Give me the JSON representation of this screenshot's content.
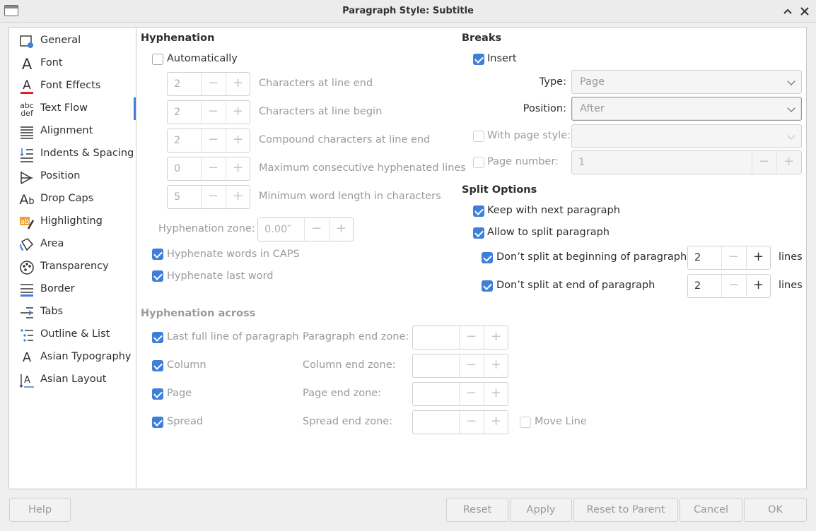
{
  "window": {
    "title": "Paragraph Style: Subtitle",
    "collapse_icon": "chevron-up-icon",
    "close_icon": "close-icon"
  },
  "sidebar": {
    "items": [
      {
        "label": "General",
        "icon": "general-icon"
      },
      {
        "label": "Font",
        "icon": "font-icon"
      },
      {
        "label": "Font Effects",
        "icon": "font-effects-icon"
      },
      {
        "label": "Text Flow",
        "icon": "text-flow-icon",
        "active": true
      },
      {
        "label": "Alignment",
        "icon": "alignment-icon"
      },
      {
        "label": "Indents & Spacing",
        "icon": "indents-spacing-icon"
      },
      {
        "label": "Position",
        "icon": "position-icon"
      },
      {
        "label": "Drop Caps",
        "icon": "drop-caps-icon"
      },
      {
        "label": "Highlighting",
        "icon": "highlighting-icon"
      },
      {
        "label": "Area",
        "icon": "area-icon"
      },
      {
        "label": "Transparency",
        "icon": "transparency-icon"
      },
      {
        "label": "Border",
        "icon": "border-icon"
      },
      {
        "label": "Tabs",
        "icon": "tabs-icon"
      },
      {
        "label": "Outline & List",
        "icon": "outline-list-icon"
      },
      {
        "label": "Asian Typography",
        "icon": "asian-typography-icon"
      },
      {
        "label": "Asian Layout",
        "icon": "asian-layout-icon"
      }
    ]
  },
  "hyphenation": {
    "heading": "Hyphenation",
    "automatically": {
      "label": "Automatically",
      "checked": false
    },
    "rows": [
      {
        "value": "2",
        "label": "Characters at line end"
      },
      {
        "value": "2",
        "label": "Characters at line begin"
      },
      {
        "value": "2",
        "label": "Compound characters at line end"
      },
      {
        "value": "0",
        "label": "Maximum consecutive hyphenated lines"
      },
      {
        "value": "5",
        "label": "Minimum word length in characters"
      }
    ],
    "zone": {
      "label": "Hyphenation zone:",
      "value": "0.00″"
    },
    "caps": {
      "label": "Hyphenate words in CAPS",
      "checked": true
    },
    "last_word": {
      "label": "Hyphenate last word",
      "checked": true
    }
  },
  "hyphenation_across": {
    "heading": "Hyphenation across",
    "rows": [
      {
        "check_label": "Last full line of paragraph",
        "checked": true,
        "zone_label": "Paragraph end zone:"
      },
      {
        "check_label": "Column",
        "checked": true,
        "zone_label": "Column end zone:"
      },
      {
        "check_label": "Page",
        "checked": true,
        "zone_label": "Page end zone:"
      },
      {
        "check_label": "Spread",
        "checked": true,
        "zone_label": "Spread end zone:"
      }
    ],
    "move_line": {
      "label": "Move Line",
      "checked": false
    }
  },
  "breaks": {
    "heading": "Breaks",
    "insert": {
      "label": "Insert",
      "checked": true
    },
    "type": {
      "label": "Type:",
      "value": "Page"
    },
    "position": {
      "label": "Position:",
      "value": "After"
    },
    "with_page_style": {
      "label": "With page style:",
      "checked": false,
      "value": ""
    },
    "page_number": {
      "label": "Page number:",
      "checked": false,
      "value": "1"
    }
  },
  "split": {
    "heading": "Split Options",
    "keep_with_next": {
      "label": "Keep with next paragraph",
      "checked": true
    },
    "allow_split": {
      "label": "Allow to split paragraph",
      "checked": true
    },
    "no_split_begin": {
      "label": "Don’t split at beginning of paragraph",
      "checked": true,
      "value": "2",
      "unit": "lines"
    },
    "no_split_end": {
      "label": "Don’t split at end of paragraph",
      "checked": true,
      "value": "2",
      "unit": "lines"
    }
  },
  "footer": {
    "help": "Help",
    "reset": "Reset",
    "apply": "Apply",
    "reset_to_parent": "Reset to Parent",
    "cancel": "Cancel",
    "ok": "OK"
  },
  "icons": {
    "minus": "−",
    "plus": "+"
  },
  "colors": {
    "accent": "#3d7fd9",
    "disabled_text": "#9a9a9a"
  }
}
